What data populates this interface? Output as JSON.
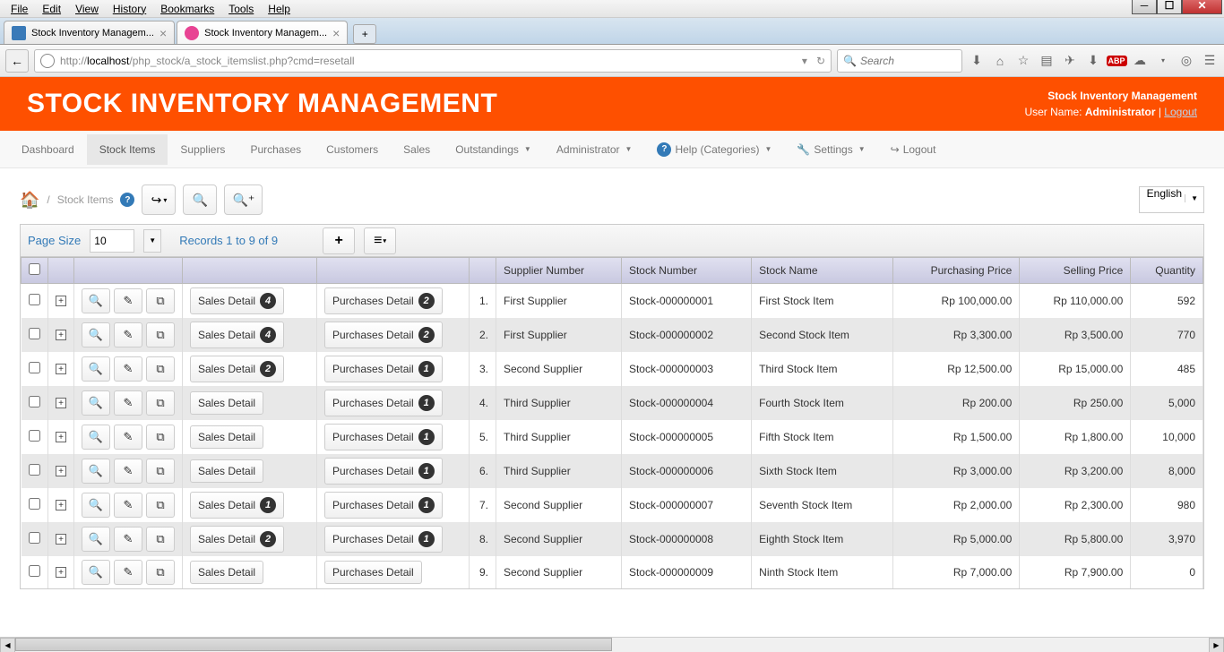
{
  "os_menu": [
    "File",
    "Edit",
    "View",
    "History",
    "Bookmarks",
    "Tools",
    "Help"
  ],
  "tabs": [
    {
      "title": "Stock Inventory Managem...",
      "active": false
    },
    {
      "title": "Stock Inventory Managem...",
      "active": true
    }
  ],
  "url": {
    "prefix": "http://",
    "host": "localhost",
    "path": "/php_stock/a_stock_itemslist.php?cmd=resetall"
  },
  "search_placeholder": "Search",
  "header": {
    "title": "STOCK INVENTORY MANAGEMENT",
    "app_name": "Stock Inventory Management",
    "user_label": "User Name:",
    "user": "Administrator",
    "logout": "Logout"
  },
  "nav": [
    {
      "label": "Dashboard",
      "active": false
    },
    {
      "label": "Stock Items",
      "active": true
    },
    {
      "label": "Suppliers",
      "active": false
    },
    {
      "label": "Purchases",
      "active": false
    },
    {
      "label": "Customers",
      "active": false
    },
    {
      "label": "Sales",
      "active": false
    },
    {
      "label": "Outstandings",
      "dropdown": true
    },
    {
      "label": "Administrator",
      "dropdown": true
    },
    {
      "label": "Help (Categories)",
      "dropdown": true,
      "icon": "?"
    },
    {
      "label": "Settings",
      "dropdown": true,
      "icon": "wrench"
    },
    {
      "label": "Logout",
      "icon": "logout"
    }
  ],
  "breadcrumb": "Stock Items",
  "language": "English",
  "table_controls": {
    "page_size_label": "Page Size",
    "page_size": "10",
    "records": "Records 1 to 9 of 9"
  },
  "columns": [
    "",
    "",
    "",
    "",
    "",
    "",
    "Supplier Number",
    "Stock Number",
    "Stock Name",
    "Purchasing Price",
    "Selling Price",
    "Quantity"
  ],
  "sales_label": "Sales Detail",
  "purchases_label": "Purchases Detail",
  "rows": [
    {
      "n": "1.",
      "sales": 4,
      "purchases": 2,
      "supplier": "First Supplier",
      "stock_no": "Stock-000000001",
      "name": "First Stock Item",
      "pprice": "Rp 100,000.00",
      "sprice": "Rp 110,000.00",
      "qty": "592"
    },
    {
      "n": "2.",
      "sales": 4,
      "purchases": 2,
      "supplier": "First Supplier",
      "stock_no": "Stock-000000002",
      "name": "Second Stock Item",
      "pprice": "Rp 3,300.00",
      "sprice": "Rp 3,500.00",
      "qty": "770"
    },
    {
      "n": "3.",
      "sales": 2,
      "purchases": 1,
      "supplier": "Second Supplier",
      "stock_no": "Stock-000000003",
      "name": "Third Stock Item",
      "pprice": "Rp 12,500.00",
      "sprice": "Rp 15,000.00",
      "qty": "485"
    },
    {
      "n": "4.",
      "sales": null,
      "purchases": 1,
      "supplier": "Third Supplier",
      "stock_no": "Stock-000000004",
      "name": "Fourth Stock Item",
      "pprice": "Rp 200.00",
      "sprice": "Rp 250.00",
      "qty": "5,000"
    },
    {
      "n": "5.",
      "sales": null,
      "purchases": 1,
      "supplier": "Third Supplier",
      "stock_no": "Stock-000000005",
      "name": "Fifth Stock Item",
      "pprice": "Rp 1,500.00",
      "sprice": "Rp 1,800.00",
      "qty": "10,000"
    },
    {
      "n": "6.",
      "sales": null,
      "purchases": 1,
      "supplier": "Third Supplier",
      "stock_no": "Stock-000000006",
      "name": "Sixth Stock Item",
      "pprice": "Rp 3,000.00",
      "sprice": "Rp 3,200.00",
      "qty": "8,000"
    },
    {
      "n": "7.",
      "sales": 1,
      "purchases": 1,
      "supplier": "Second Supplier",
      "stock_no": "Stock-000000007",
      "name": "Seventh Stock Item",
      "pprice": "Rp 2,000.00",
      "sprice": "Rp 2,300.00",
      "qty": "980"
    },
    {
      "n": "8.",
      "sales": 2,
      "purchases": 1,
      "supplier": "Second Supplier",
      "stock_no": "Stock-000000008",
      "name": "Eighth Stock Item",
      "pprice": "Rp 5,000.00",
      "sprice": "Rp 5,800.00",
      "qty": "3,970"
    },
    {
      "n": "9.",
      "sales": null,
      "purchases": null,
      "supplier": "Second Supplier",
      "stock_no": "Stock-000000009",
      "name": "Ninth Stock Item",
      "pprice": "Rp 7,000.00",
      "sprice": "Rp 7,900.00",
      "qty": "0"
    }
  ]
}
